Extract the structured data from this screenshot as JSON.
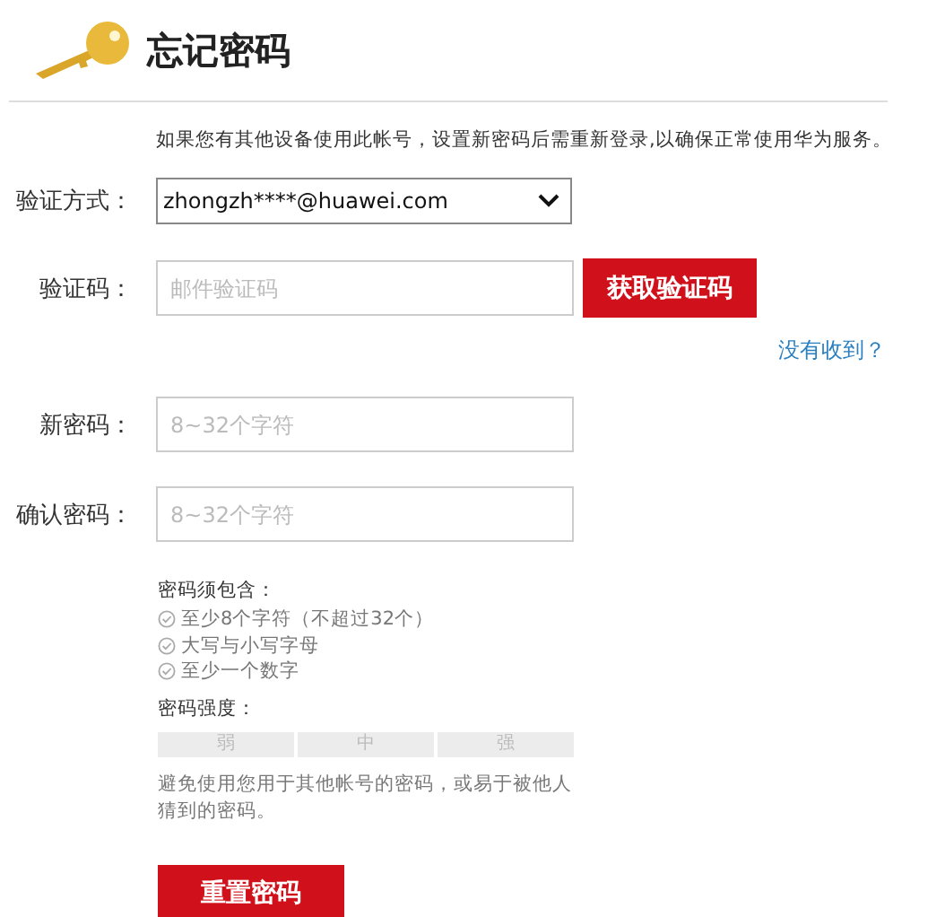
{
  "title": "忘记密码",
  "notice": "如果您有其他设备使用此帐号，设置新密码后需重新登录,以确保正常使用华为服务。",
  "fields": [
    {
      "kind": "select",
      "label": "验证方式：",
      "value": "zhongzh****@huawei.com"
    },
    {
      "kind": "code",
      "label": "验证码：",
      "placeholder": "邮件验证码",
      "button": "获取验证码",
      "link": "没有收到？"
    },
    {
      "kind": "text",
      "label": "新密码：",
      "placeholder": "8~32个字符"
    },
    {
      "kind": "text",
      "label": "确认密码：",
      "placeholder": "8~32个字符"
    }
  ],
  "rules_title": "密码须包含：",
  "rules": [
    {
      "text": "至少8个字符（不超过32个）",
      "checked": false
    },
    {
      "text": "大写与小写字母",
      "checked": false
    },
    {
      "text": "至少一个数字",
      "checked": false
    }
  ],
  "strength_title": "密码强度：",
  "strength": [
    {
      "label": "弱",
      "active": false
    },
    {
      "label": "中",
      "active": false
    },
    {
      "label": "强",
      "active": false
    }
  ],
  "hint": "避免使用您用于其他帐号的密码，或易于被他人猜到的密码。",
  "submit": "重置密码"
}
